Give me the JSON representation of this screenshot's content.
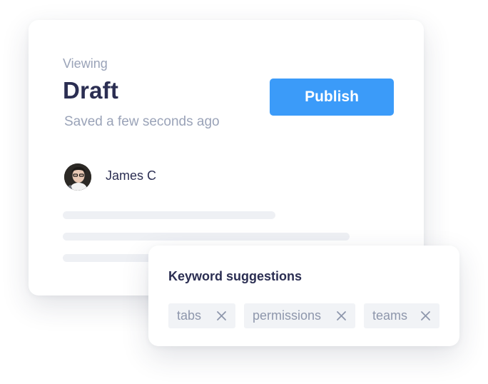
{
  "draft_card": {
    "viewing_label": "Viewing",
    "title": "Draft",
    "saved_status": "Saved a few seconds ago",
    "publish_label": "Publish",
    "author_name": "James C"
  },
  "keywords": {
    "title": "Keyword suggestions",
    "chips": [
      {
        "label": "tabs",
        "icon": "close-icon"
      },
      {
        "label": "permissions",
        "icon": "close-icon"
      },
      {
        "label": "teams",
        "icon": "close-icon"
      }
    ]
  },
  "colors": {
    "accent": "#3b9bf9",
    "heading": "#2b2e52",
    "muted": "#9aa3b8",
    "chip_bg": "#f1f3f6"
  }
}
